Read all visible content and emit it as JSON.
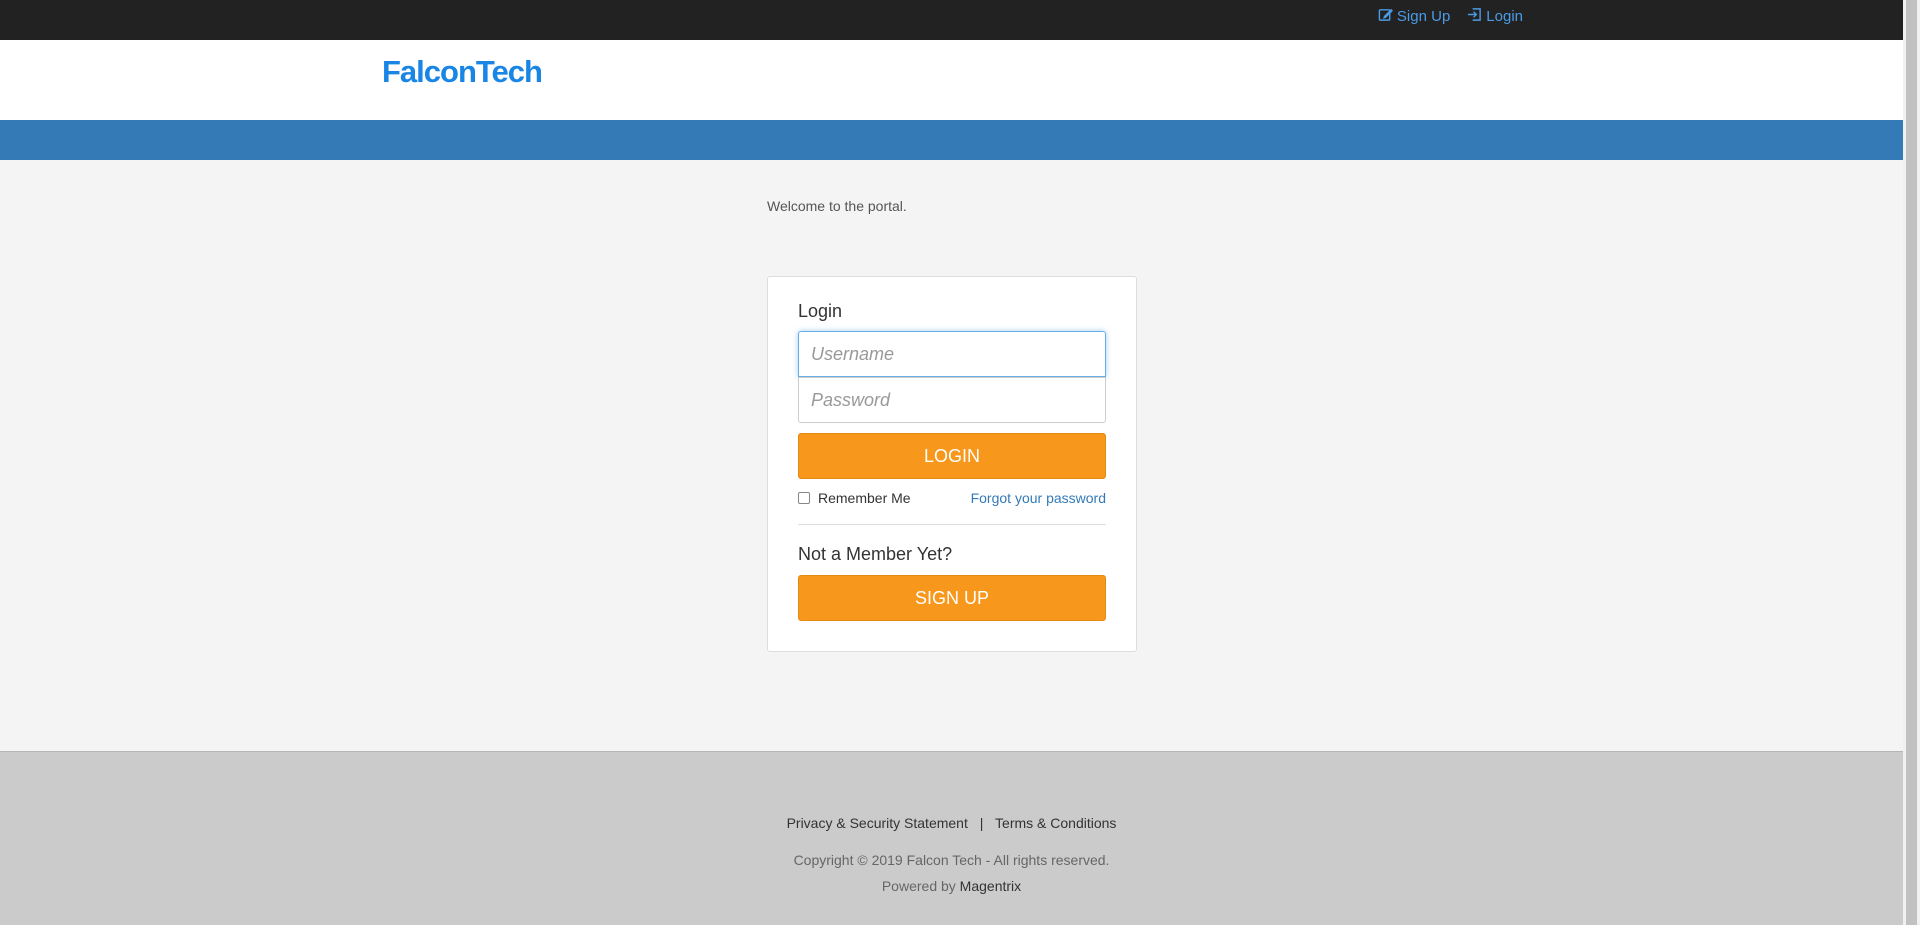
{
  "topbar": {
    "signup_label": "Sign Up",
    "login_label": "Login",
    "link_color": "#4a9be6",
    "background": "#222222"
  },
  "header": {
    "logo": "FalconTech",
    "logo_color": "#1985e4"
  },
  "bluebar_color": "#337ab7",
  "welcome_text": "Welcome to the portal.",
  "login_card": {
    "title": "Login",
    "username_placeholder": "Username",
    "password_placeholder": "Password",
    "login_button": "LOGIN",
    "remember_me": "Remember Me",
    "forgot_password": "Forgot your password",
    "not_member": "Not a Member Yet?",
    "signup_button": "SIGN UP",
    "button_color": "#f7971b"
  },
  "footer": {
    "privacy": "Privacy & Security Statement",
    "separator": "|",
    "terms": "Terms & Conditions",
    "copyright": "Copyright © 2019 Falcon Tech - All rights reserved.",
    "powered_by": "Powered by",
    "powered_brand": "Magentrix"
  }
}
